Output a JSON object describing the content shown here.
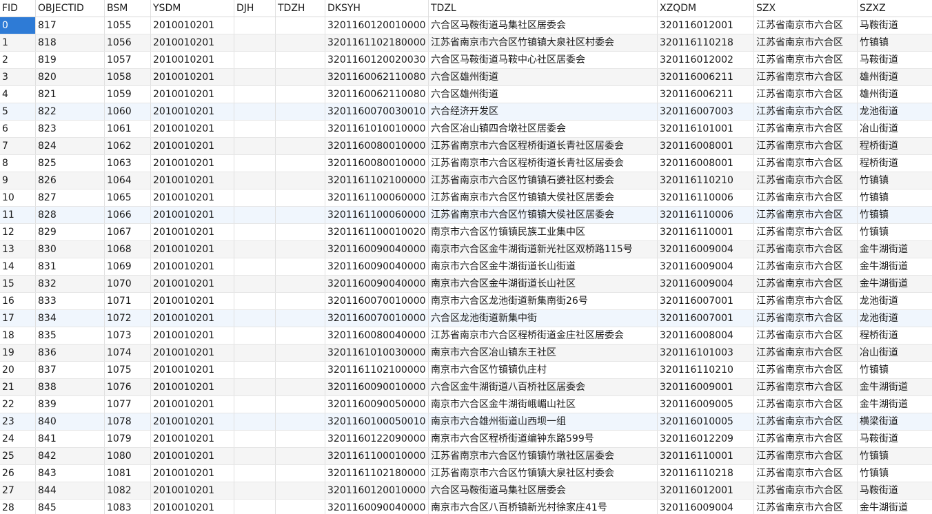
{
  "table": {
    "columns": [
      "FID",
      "OBJECTID",
      "BSM",
      "YSDM",
      "DJH",
      "TDZH",
      "DKSYH",
      "TDZL",
      "XZQDM",
      "SZX",
      "SZXZ"
    ],
    "rows": [
      [
        "0",
        "817",
        "1055",
        "2010010201",
        "",
        "",
        "3201160120010000",
        "六合区马鞍街道马集社区居委会",
        "320116012001",
        "江苏省南京市六合区",
        "马鞍街道"
      ],
      [
        "1",
        "818",
        "1056",
        "2010010201",
        "",
        "",
        "3201161102180000",
        "江苏省南京市六合区竹镇镇大泉社区村委会",
        "320116110218",
        "江苏省南京市六合区",
        "竹镇镇"
      ],
      [
        "2",
        "819",
        "1057",
        "2010010201",
        "",
        "",
        "3201160120020030",
        "六合区马鞍街道马鞍中心社区居委会",
        "320116012002",
        "江苏省南京市六合区",
        "马鞍街道"
      ],
      [
        "3",
        "820",
        "1058",
        "2010010201",
        "",
        "",
        "3201160062110080",
        "六合区雄州街道",
        "320116006211",
        "江苏省南京市六合区",
        "雄州街道"
      ],
      [
        "4",
        "821",
        "1059",
        "2010010201",
        "",
        "",
        "3201160062110080",
        "六合区雄州街道",
        "320116006211",
        "江苏省南京市六合区",
        "雄州街道"
      ],
      [
        "5",
        "822",
        "1060",
        "2010010201",
        "",
        "",
        "3201160070030010",
        "六合经济开发区",
        "320116007003",
        "江苏省南京市六合区",
        "龙池街道"
      ],
      [
        "6",
        "823",
        "1061",
        "2010010201",
        "",
        "",
        "3201161010010000",
        "六合区冶山镇四合墩社区居委会",
        "320116101001",
        "江苏省南京市六合区",
        "冶山街道"
      ],
      [
        "7",
        "824",
        "1062",
        "2010010201",
        "",
        "",
        "3201160080010000",
        "江苏省南京市六合区程桥街道长青社区居委会",
        "320116008001",
        "江苏省南京市六合区",
        "程桥街道"
      ],
      [
        "8",
        "825",
        "1063",
        "2010010201",
        "",
        "",
        "3201160080010000",
        "江苏省南京市六合区程桥街道长青社区居委会",
        "320116008001",
        "江苏省南京市六合区",
        "程桥街道"
      ],
      [
        "9",
        "826",
        "1064",
        "2010010201",
        "",
        "",
        "3201161102100000",
        "江苏省南京市六合区竹镇镇石婆社区村委会",
        "320116110210",
        "江苏省南京市六合区",
        "竹镇镇"
      ],
      [
        "10",
        "827",
        "1065",
        "2010010201",
        "",
        "",
        "3201161100060000",
        "江苏省南京市六合区竹镇镇大侯社区居委会",
        "320116110006",
        "江苏省南京市六合区",
        "竹镇镇"
      ],
      [
        "11",
        "828",
        "1066",
        "2010010201",
        "",
        "",
        "3201161100060000",
        "江苏省南京市六合区竹镇镇大侯社区居委会",
        "320116110006",
        "江苏省南京市六合区",
        "竹镇镇"
      ],
      [
        "12",
        "829",
        "1067",
        "2010010201",
        "",
        "",
        "3201161100010020",
        "南京市六合区竹镇镇民族工业集中区",
        "320116110001",
        "江苏省南京市六合区",
        "竹镇镇"
      ],
      [
        "13",
        "830",
        "1068",
        "2010010201",
        "",
        "",
        "3201160090040000",
        "南京市六合区金牛湖街道新光社区双桥路115号",
        "320116009004",
        "江苏省南京市六合区",
        "金牛湖街道"
      ],
      [
        "14",
        "831",
        "1069",
        "2010010201",
        "",
        "",
        "3201160090040000",
        "南京市六合区金牛湖街道长山街道",
        "320116009004",
        "江苏省南京市六合区",
        "金牛湖街道"
      ],
      [
        "15",
        "832",
        "1070",
        "2010010201",
        "",
        "",
        "3201160090040000",
        "南京市六合区金牛湖街道长山社区",
        "320116009004",
        "江苏省南京市六合区",
        "金牛湖街道"
      ],
      [
        "16",
        "833",
        "1071",
        "2010010201",
        "",
        "",
        "3201160070010000",
        "南京市六合区龙池街道新集南街26号",
        "320116007001",
        "江苏省南京市六合区",
        "龙池街道"
      ],
      [
        "17",
        "834",
        "1072",
        "2010010201",
        "",
        "",
        "3201160070010000",
        "六合区龙池街道新集中街",
        "320116007001",
        "江苏省南京市六合区",
        "龙池街道"
      ],
      [
        "18",
        "835",
        "1073",
        "2010010201",
        "",
        "",
        "3201160080040000",
        "江苏省南京市六合区程桥街道金庄社区居委会",
        "320116008004",
        "江苏省南京市六合区",
        "程桥街道"
      ],
      [
        "19",
        "836",
        "1074",
        "2010010201",
        "",
        "",
        "3201161010030000",
        "南京市六合区冶山镇东王社区",
        "320116101003",
        "江苏省南京市六合区",
        "冶山街道"
      ],
      [
        "20",
        "837",
        "1075",
        "2010010201",
        "",
        "",
        "3201161102100000",
        "南京市六合区竹镇镇仇庄村",
        "320116110210",
        "江苏省南京市六合区",
        "竹镇镇"
      ],
      [
        "21",
        "838",
        "1076",
        "2010010201",
        "",
        "",
        "3201160090010000",
        "六合区金牛湖街道八百桥社区居委会",
        "320116009001",
        "江苏省南京市六合区",
        "金牛湖街道"
      ],
      [
        "22",
        "839",
        "1077",
        "2010010201",
        "",
        "",
        "3201160090050000",
        "南京市六合区金牛湖街峨嵋山社区",
        "320116009005",
        "江苏省南京市六合区",
        "金牛湖街道"
      ],
      [
        "23",
        "840",
        "1078",
        "2010010201",
        "",
        "",
        "3201160100050010",
        "南京市六合雄州街道山西坝一组",
        "320116010005",
        "江苏省南京市六合区",
        "横梁街道"
      ],
      [
        "24",
        "841",
        "1079",
        "2010010201",
        "",
        "",
        "3201160122090000",
        "南京市六合区程桥街道编钟东路599号",
        "320116012209",
        "江苏省南京市六合区",
        "马鞍街道"
      ],
      [
        "25",
        "842",
        "1080",
        "2010010201",
        "",
        "",
        "3201161100010000",
        "江苏省南京市六合区竹镇镇竹墩社区居委会",
        "320116110001",
        "江苏省南京市六合区",
        "竹镇镇"
      ],
      [
        "26",
        "843",
        "1081",
        "2010010201",
        "",
        "",
        "3201161102180000",
        "江苏省南京市六合区竹镇镇大泉社区村委会",
        "320116110218",
        "江苏省南京市六合区",
        "竹镇镇"
      ],
      [
        "27",
        "844",
        "1082",
        "2010010201",
        "",
        "",
        "3201160120010000",
        "六合区马鞍街道马集社区居委会",
        "320116012001",
        "江苏省南京市六合区",
        "马鞍街道"
      ],
      [
        "28",
        "845",
        "1083",
        "2010010201",
        "",
        "",
        "3201160090040000",
        "南京市六合区八百桥镇新光村徐家庄41号",
        "320116009004",
        "江苏省南京市六合区",
        "金牛湖街道"
      ]
    ]
  },
  "colors": {
    "selection": "#2e7bd6",
    "row_alt": "#f5f5f5",
    "row_highlight": "#f0f6fd",
    "grid_line": "#e0e0e0"
  }
}
